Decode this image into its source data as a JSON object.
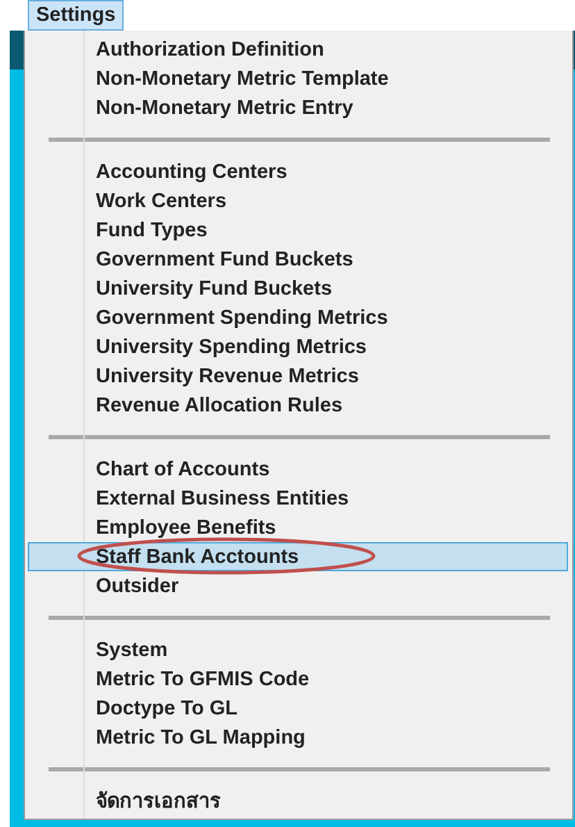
{
  "menu_bar": [
    {
      "label": "Settings",
      "selected": true
    }
  ],
  "menu": {
    "groups": [
      [
        {
          "label": "Authorization Definition",
          "selected": false,
          "circled": false
        },
        {
          "label": "Non-Monetary Metric Template",
          "selected": false,
          "circled": false
        },
        {
          "label": "Non-Monetary Metric Entry",
          "selected": false,
          "circled": false
        }
      ],
      [
        {
          "label": "Accounting Centers",
          "selected": false,
          "circled": false
        },
        {
          "label": "Work Centers",
          "selected": false,
          "circled": false
        },
        {
          "label": "Fund Types",
          "selected": false,
          "circled": false
        },
        {
          "label": "Government Fund Buckets",
          "selected": false,
          "circled": false
        },
        {
          "label": "University Fund Buckets",
          "selected": false,
          "circled": false
        },
        {
          "label": "Government Spending Metrics",
          "selected": false,
          "circled": false
        },
        {
          "label": "University Spending Metrics",
          "selected": false,
          "circled": false
        },
        {
          "label": "University Revenue Metrics",
          "selected": false,
          "circled": false
        },
        {
          "label": "Revenue Allocation Rules",
          "selected": false,
          "circled": false
        }
      ],
      [
        {
          "label": "Chart of Accounts",
          "selected": false,
          "circled": false
        },
        {
          "label": "External Business Entities",
          "selected": false,
          "circled": false
        },
        {
          "label": "Employee Benefits",
          "selected": false,
          "circled": false
        },
        {
          "label": "Staff Bank Acctounts",
          "selected": true,
          "circled": true
        },
        {
          "label": "Outsider",
          "selected": false,
          "circled": false
        }
      ],
      [
        {
          "label": "System",
          "selected": false,
          "circled": false
        },
        {
          "label": "Metric To GFMIS Code",
          "selected": false,
          "circled": false
        },
        {
          "label": "Doctype To GL",
          "selected": false,
          "circled": false
        },
        {
          "label": "Metric To GL Mapping",
          "selected": false,
          "circled": false
        }
      ],
      [
        {
          "label": "จัดการเอกสาร",
          "selected": false,
          "circled": false
        }
      ]
    ]
  }
}
